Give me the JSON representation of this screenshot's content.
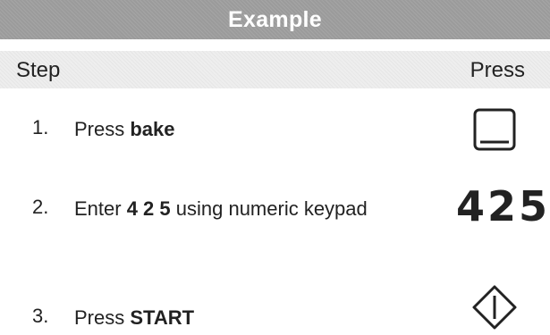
{
  "header": {
    "title": "Example"
  },
  "columns": {
    "step": "Step",
    "press": "Press"
  },
  "steps": [
    {
      "number": "1.",
      "prefix": "Press ",
      "bold": "bake",
      "suffix": "",
      "press_icon": "bake-button-icon"
    },
    {
      "number": "2.",
      "prefix": "Enter ",
      "bold": "4 2 5",
      "suffix": " using numeric keypad",
      "press_value": "425"
    },
    {
      "number": "3.",
      "prefix": "Press ",
      "bold": "START",
      "suffix": "",
      "press_icon": "start-diamond-icon"
    }
  ],
  "colors": {
    "header_bg": "#9b9b9b",
    "subheader_bg": "#eeeeee",
    "text": "#222222"
  }
}
